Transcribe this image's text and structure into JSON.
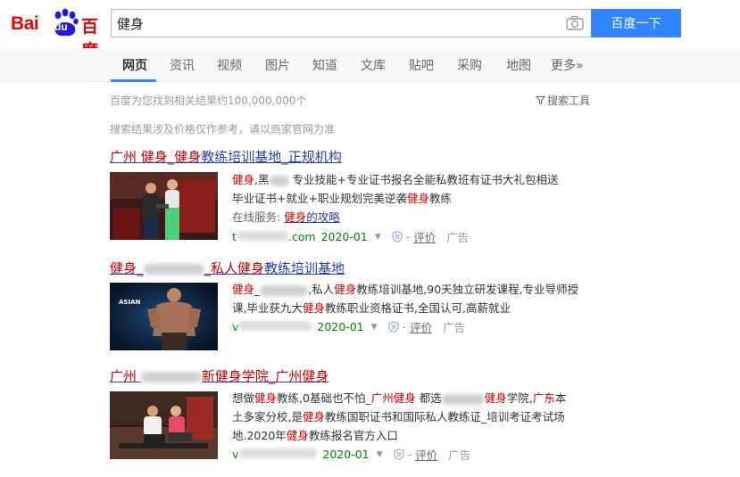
{
  "logo": {
    "part1": "Bai",
    "part2": "du",
    "part3": "百度"
  },
  "search": {
    "query": "健身",
    "button": "百度一下"
  },
  "nav": {
    "items": [
      "网页",
      "资讯",
      "视频",
      "图片",
      "知道",
      "文库",
      "贴吧",
      "采购",
      "地图",
      "更多»"
    ]
  },
  "stats": {
    "count_text": "百度为您找到相关结果约100,000,000个",
    "tools_label": "搜索工具"
  },
  "notice": "搜索结果涉及价格仅作参考，请以商家官网为准",
  "results": [
    {
      "title": {
        "a": "广州 健身_",
        "b": "健身",
        "c": "教练培训基地_正规机构"
      },
      "desc": {
        "l1a": "健身",
        "l1b": ",黑",
        "l1c": " 专业技能+专业证书报名全能私教班有证书大礼包相送",
        "l2a": "毕业证书+就业+职业规划完美逆袭",
        "l2b": "健身",
        "l2c": "教练",
        "svc_label": "在线服务: ",
        "svc_a": "健身",
        "svc_b": "的攻略"
      },
      "meta": {
        "url_prefix": "t",
        "url_suffix": ".com",
        "date": "2020-01",
        "eval": "评价",
        "ad": "广告",
        "dash": "-"
      }
    },
    {
      "title": {
        "a": "健身_",
        "b": "_私人",
        "c": "健身",
        "d": "教练培训基地"
      },
      "desc": {
        "l1a": "健身",
        "l1b": "_",
        "l1c": ",私人",
        "l1d": "健身",
        "l1e": "教练培训基地,90天独立研发课程,专业导师授",
        "l2a": "课,毕业获九大",
        "l2b": "健身",
        "l2c": "教练职业资格证书,全国认可,高薪就业"
      },
      "meta": {
        "url_prefix": "v",
        "url_suffix": "",
        "date": "2020-01",
        "eval": "评价",
        "ad": "广告",
        "dash": "-"
      }
    },
    {
      "title": {
        "a": "广州 ",
        "b": "新",
        "c": "健身",
        "d": "学院_广州",
        "e": "健身"
      },
      "desc": {
        "l1a": "想做",
        "l1b": "健身",
        "l1c": "教练,0基础也不怕_",
        "l1d": "广州健身",
        "l1e": " 都选",
        "l1f": "健身",
        "l1g": "学院,",
        "l1h": "广东",
        "l1i": "本",
        "l2a": "土多家分校,是",
        "l2b": "健身",
        "l2c": "教练国职证书和国际私人教练证_培训考证考试场",
        "l3a": "地.2020年",
        "l3b": "健身",
        "l3c": "教练报名官方入口"
      },
      "meta": {
        "url_prefix": "v",
        "url_suffix": "",
        "date": "2020-01",
        "eval": "评价",
        "ad": "广告",
        "dash": "-"
      }
    }
  ],
  "colors": {
    "brand_red": "#e10602",
    "brand_blue": "#2319dc",
    "button": "#3385ff",
    "title_link": "#2440b3",
    "highlight": "#c00000",
    "url_green": "#008000"
  },
  "icons": [
    "baidu-paw-icon",
    "camera-icon",
    "filter-icon",
    "caret-down-icon",
    "shield-icon"
  ]
}
